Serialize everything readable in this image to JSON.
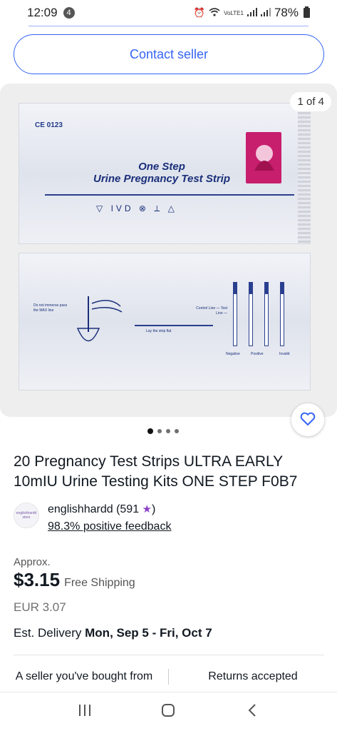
{
  "status_bar": {
    "time": "12:09",
    "notification_count": "4",
    "network": "VoLTE1",
    "battery": "78%"
  },
  "contact_seller": {
    "label": "Contact seller"
  },
  "gallery": {
    "counter": "1 of 4",
    "total_images": 4,
    "active_index": 0,
    "image": {
      "ce_mark": "CE 0123",
      "product_line1": "One Step",
      "product_line2": "Urine Pregnancy Test Strip",
      "instruction_left": "Do not immerse pass the MAX line",
      "instruction_middle": "Lay the strip flat",
      "instruction_right": "Control Line — Test Line —",
      "result_labels": [
        "Negative",
        "Positive",
        "Invalid"
      ]
    }
  },
  "listing": {
    "title": "20 Pregnancy Test Strips ULTRA EARLY 10mIU Urine Testing Kits ONE STEP F0B7"
  },
  "seller": {
    "avatar_text": "englishhardd store",
    "name_prefix": "englishhardd (591",
    "name_suffix": ")",
    "feedback": "98.3% positive feedback"
  },
  "price": {
    "approx_label": "Approx.",
    "amount": "$3.15",
    "shipping": "Free Shipping",
    "original": "EUR 3.07"
  },
  "delivery": {
    "label": "Est. Delivery ",
    "dates": "Mon, Sep 5 - Fri, Oct 7"
  },
  "badges": {
    "left": "A seller you've bought from",
    "right": "Returns accepted"
  },
  "colors": {
    "accent": "#3665f3",
    "star": "#8b3fc7",
    "text": "#111820"
  }
}
